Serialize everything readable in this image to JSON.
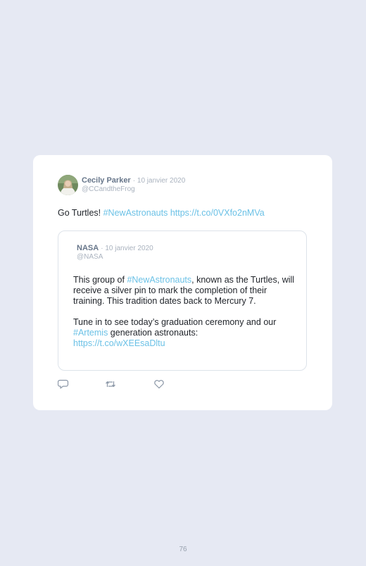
{
  "tweet": {
    "author_name": "Cecily Parker",
    "date": "· 10 janvier 2020",
    "handle": "@CCandtheFrog",
    "text_prefix": "Go Turtles! ",
    "hashtag": "#NewAstronauts",
    "link": "https://t.co/0VXfo2nMVa"
  },
  "quoted_tweet": {
    "author_name": "NASA",
    "date": "· 10 janvier 2020",
    "handle": "@NASA",
    "p1_prefix": "This group of ",
    "p1_hashtag": "#NewAstronauts",
    "p1_suffix": ", known as the Turtles, will receive a silver pin to mark the completion of their training. This tradition dates back to Mercury 7.",
    "p2_prefix": "Tune in to see today’s graduation ceremony and our ",
    "p2_hashtag": "#Artemis",
    "p2_suffix": " generation astronauts:",
    "p2_link": "https://t.co/wXEEsaDltu"
  },
  "actions": {
    "reply_icon": "reply-icon",
    "retweet_icon": "retweet-icon",
    "like_icon": "heart-icon"
  },
  "colors": {
    "background": "#e6e9f3",
    "card": "#ffffff",
    "link": "#6bc1e6",
    "muted": "#aab3bf",
    "author": "#67768a"
  },
  "page_number": "76"
}
